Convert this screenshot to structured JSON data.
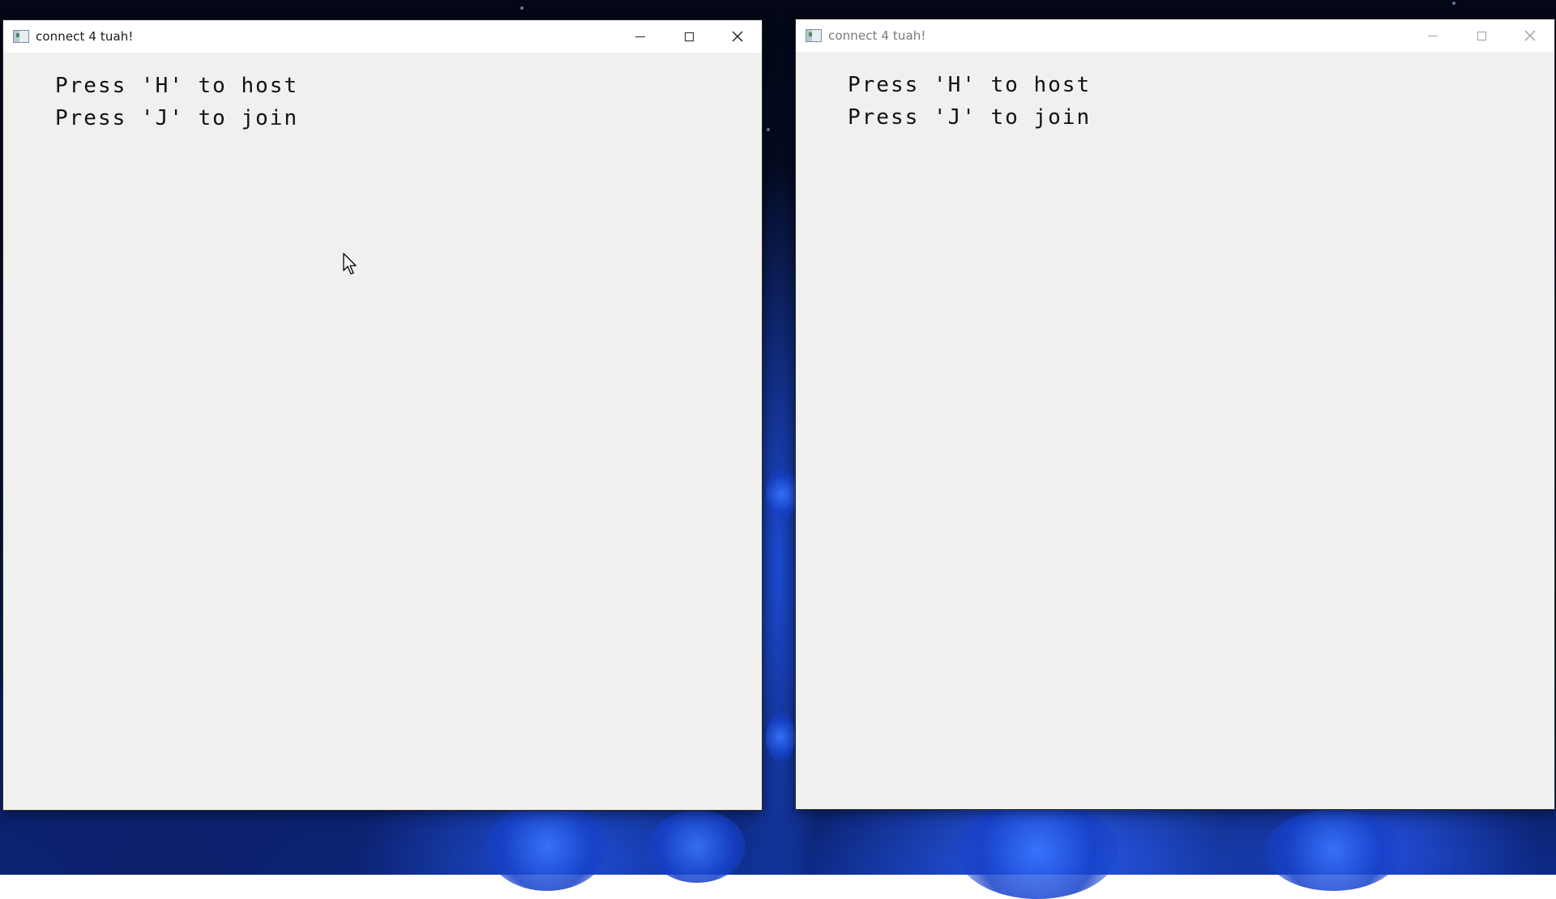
{
  "desktop": {
    "accent_color": "#2a5cf0"
  },
  "windows": [
    {
      "title": "connect 4 tuah!",
      "state": "active",
      "controls": {
        "minimize": "minimize-icon",
        "maximize": "maximize-icon",
        "close": "close-icon"
      },
      "lines": [
        "Press 'H' to host",
        "Press 'J' to join"
      ]
    },
    {
      "title": "connect 4 tuah!",
      "state": "inactive",
      "controls": {
        "minimize": "minimize-icon",
        "maximize": "maximize-icon",
        "close": "close-icon"
      },
      "lines": [
        "Press 'H' to host",
        "Press 'J' to join"
      ]
    }
  ],
  "mouse_cursor": "arrow-cursor-icon"
}
